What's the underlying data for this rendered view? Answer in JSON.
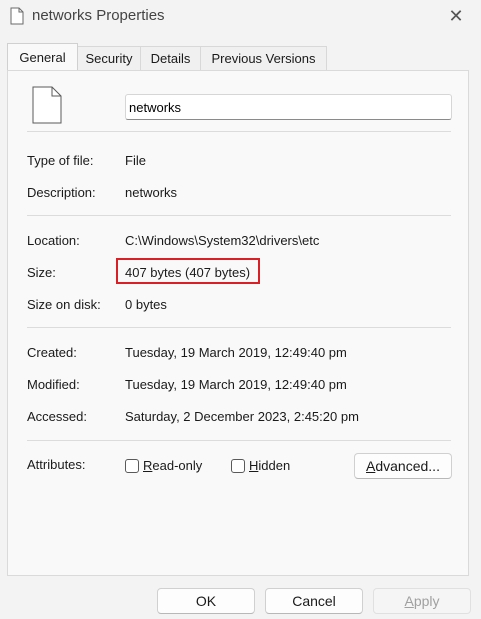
{
  "window": {
    "title": "networks Properties",
    "close_label": "✕"
  },
  "tabs": [
    {
      "label": "General",
      "active": true
    },
    {
      "label": "Security"
    },
    {
      "label": "Details"
    },
    {
      "label": "Previous Versions"
    }
  ],
  "general": {
    "file_name": "networks",
    "type_label": "Type of file:",
    "type_value": "File",
    "description_label": "Description:",
    "description_value": "networks",
    "location_label": "Location:",
    "location_value": "C:\\Windows\\System32\\drivers\\etc",
    "size_label": "Size:",
    "size_value": "407 bytes (407 bytes)",
    "size_on_disk_label": "Size on disk:",
    "size_on_disk_value": "0 bytes",
    "created_label": "Created:",
    "created_value": "Tuesday, 19 March 2019, 12:49:40 pm",
    "modified_label": "Modified:",
    "modified_value": "Tuesday, 19 March 2019, 12:49:40 pm",
    "accessed_label": "Accessed:",
    "accessed_value": "Saturday, 2 December 2023, 2:45:20 pm",
    "attributes_label": "Attributes:",
    "readonly_first": "R",
    "readonly_rest": "ead-only",
    "hidden_first": "H",
    "hidden_rest": "idden",
    "advanced_first": "A",
    "advanced_rest": "dvanced..."
  },
  "footer": {
    "ok_label": "OK",
    "cancel_label": "Cancel",
    "apply_first": "A",
    "apply_rest": "pply"
  },
  "colors": {
    "highlight_border": "#d92027"
  },
  "icons": {
    "title": "document-icon",
    "file": "document-icon",
    "close": "close-icon"
  }
}
